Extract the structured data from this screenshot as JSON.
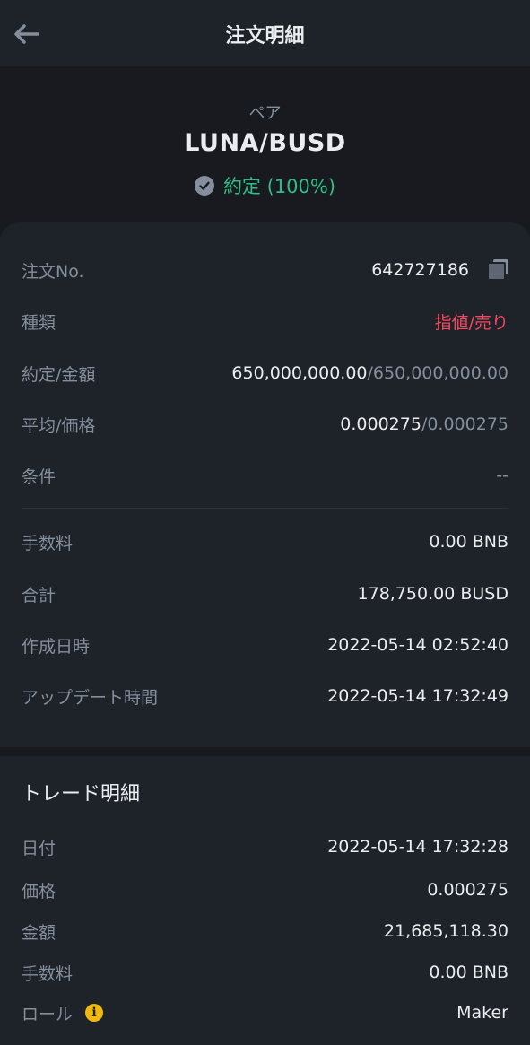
{
  "header": {
    "title": "注文明細",
    "back_icon": "arrow-left-icon"
  },
  "summary": {
    "pair_label": "ペア",
    "pair": "LUNA/BUSD",
    "status_text": "約定",
    "status_percent": "(100%)",
    "status_color": "#2ebd85"
  },
  "order": {
    "order_no_label": "注文No.",
    "order_no": "642727186",
    "type_label": "種類",
    "type_value": "指値/売り",
    "filled_label": "約定/金額",
    "filled_value": "650,000,000.00",
    "filled_total": "/650,000,000.00",
    "avg_label": "平均/価格",
    "avg_value": "0.000275",
    "avg_price": "/0.000275",
    "cond_label": "条件",
    "cond_value": "--",
    "fee_label": "手数料",
    "fee_value": "0.00 BNB",
    "total_label": "合計",
    "total_value": "178,750.00 BUSD",
    "created_label": "作成日時",
    "created_value": "2022-05-14 02:52:40",
    "updated_label": "アップデート時間",
    "updated_value": "2022-05-14 17:32:49"
  },
  "trade": {
    "title": "トレード明細",
    "date_label": "日付",
    "date_value": "2022-05-14 17:32:28",
    "price_label": "価格",
    "price_value": "0.000275",
    "amount_label": "金額",
    "amount_value": "21,685,118.30",
    "fee_label": "手数料",
    "fee_value": "0.00 BNB",
    "role_label": "ロール",
    "role_value": "Maker",
    "info_glyph": "i"
  },
  "colors": {
    "bg": "#1e2329",
    "accent_green": "#2ebd85",
    "accent_red": "#f6465d",
    "info_yellow": "#f0b90b"
  }
}
